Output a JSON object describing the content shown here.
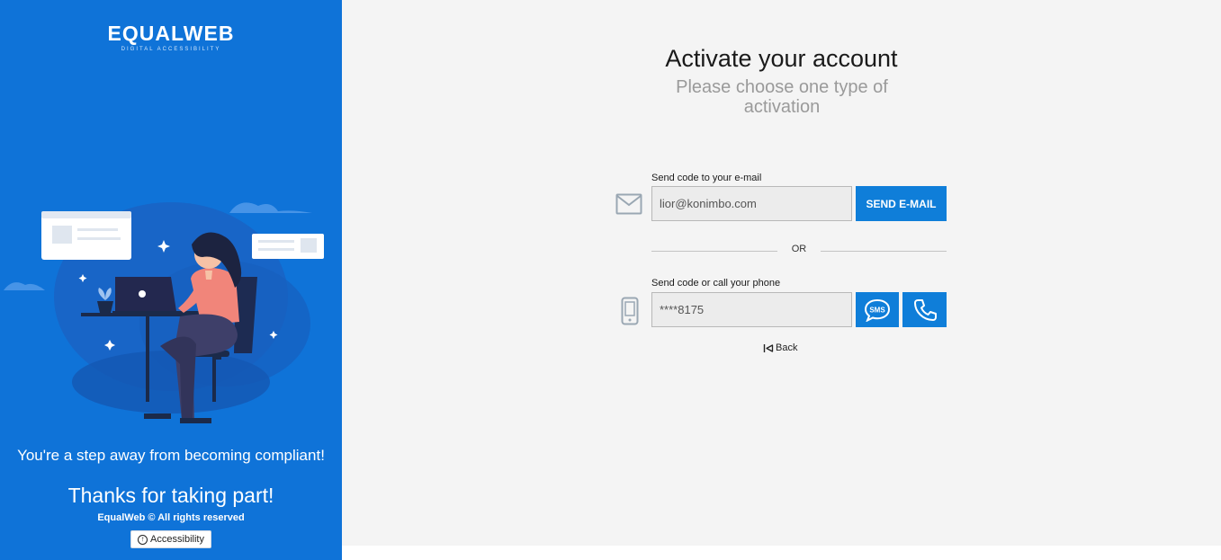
{
  "brand": {
    "logo_text": "EQUALWEB",
    "logo_tagline": "DIGITAL ACCESSIBILITY"
  },
  "left_panel": {
    "tagline": "You're a step away from becoming compliant!",
    "thanks": "Thanks for taking part!",
    "rights": "EqualWeb © All rights reserved",
    "accessibility_button": "Accessibility"
  },
  "main": {
    "title": "Activate your account",
    "subtitle": "Please choose one type of activation",
    "email": {
      "label": "Send code to your e-mail",
      "value": "lior@konimbo.com",
      "button": "SEND E-MAIL",
      "icon": "envelope-icon"
    },
    "or_text": "OR",
    "phone": {
      "label": "Send code or call your phone",
      "value": "****8175",
      "sms_icon": "sms-icon",
      "call_icon": "phone-call-icon",
      "icon": "mobile-phone-icon"
    },
    "back_label": "Back"
  },
  "colors": {
    "brand_blue": "#0f73d8",
    "button_blue": "#0f7ed9",
    "page_bg": "#f4f4f4"
  }
}
